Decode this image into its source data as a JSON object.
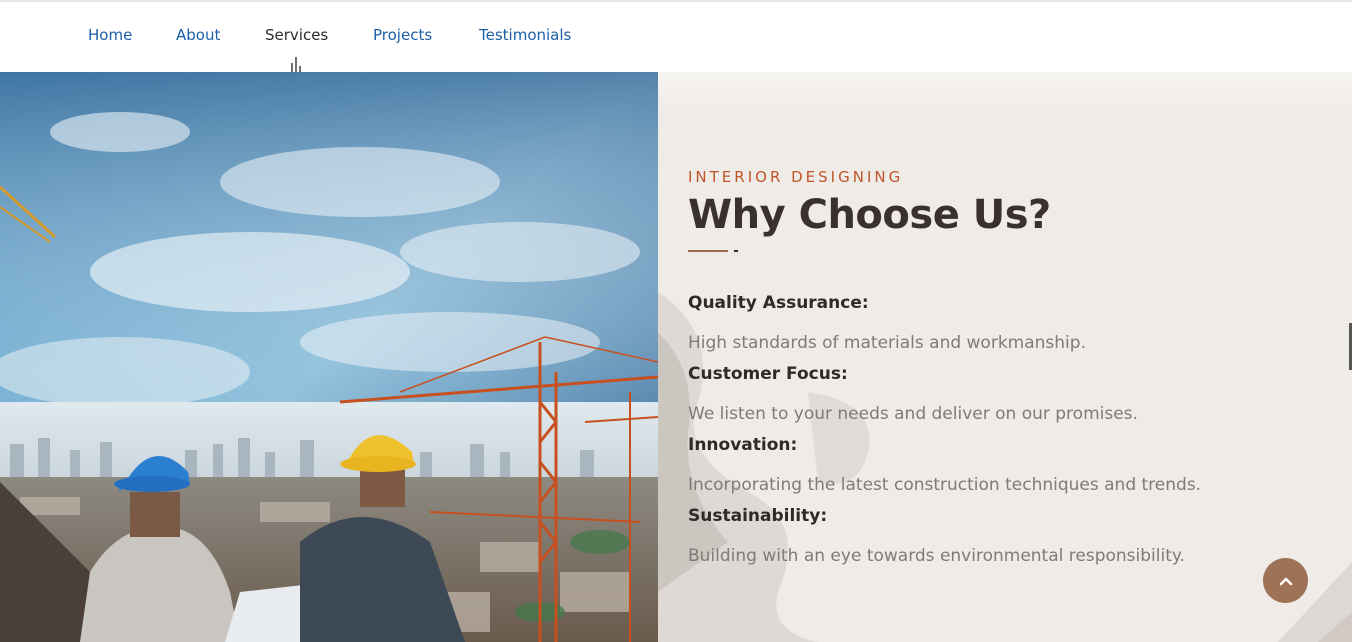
{
  "nav": {
    "items": [
      {
        "label": "Home"
      },
      {
        "label": "About"
      },
      {
        "label": "Services"
      },
      {
        "label": "Projects"
      },
      {
        "label": "Testimonials"
      }
    ],
    "active": "Services"
  },
  "section": {
    "eyebrow": "INTERIOR DESIGNING",
    "title": "Why Choose Us?",
    "features": [
      {
        "title": "Quality Assurance:",
        "description": "High standards of materials and workmanship."
      },
      {
        "title": "Customer Focus:",
        "description": "We listen to your needs and deliver on our promises."
      },
      {
        "title": "Innovation:",
        "description": "Incorporating the latest construction techniques and trends."
      },
      {
        "title": "Sustainability:",
        "description": "Building with an eye towards environmental responsibility."
      }
    ]
  },
  "icons": {
    "scroll_top": "chevron-up-icon"
  },
  "colors": {
    "accent": "#c0552b",
    "nav_link": "#1c5fa8",
    "heading": "#3a302d",
    "body_text": "#817a75",
    "panel_bg": "#efebe7",
    "button_bg": "#9e7256"
  }
}
